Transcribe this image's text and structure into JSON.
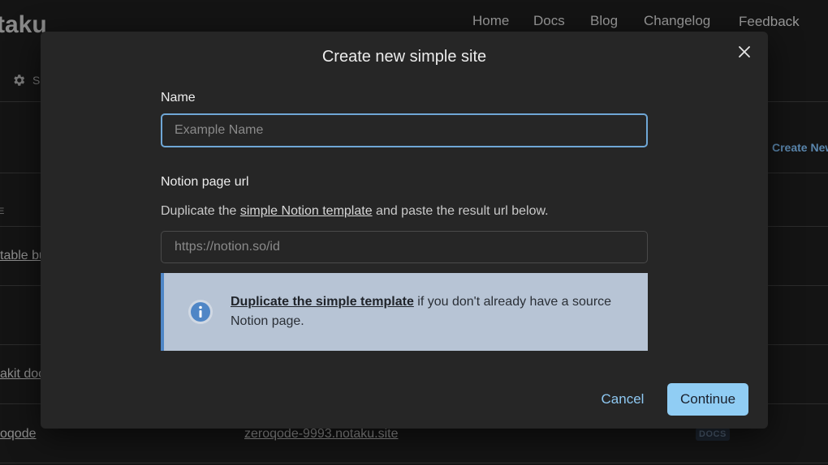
{
  "background": {
    "logo_text": "taku",
    "nav": {
      "home": "Home",
      "docs": "Docs",
      "blog": "Blog",
      "changelog": "Changelog",
      "feedback": "Feedback"
    },
    "settings_label": "S",
    "create_new_label": "Create New",
    "column_label": "E",
    "rows": [
      {
        "link": "table bu"
      },
      {
        "link": "akit doc"
      },
      {
        "link": "oqode"
      }
    ],
    "domain": "zeroqode-9993.notaku.site",
    "badge": "DOCS"
  },
  "modal": {
    "title": "Create new simple site",
    "close_icon": "close-icon",
    "name_field": {
      "label": "Name",
      "placeholder": "Example Name",
      "value": ""
    },
    "url_field": {
      "label": "Notion page url",
      "help_prefix": "Duplicate the ",
      "help_link": "simple Notion template",
      "help_suffix": " and paste the result url below.",
      "placeholder": "https://notion.so/id",
      "value": ""
    },
    "info": {
      "icon": "info-icon",
      "link_text": "Duplicate the simple template",
      "text": " if you don't already have a source Notion page."
    },
    "buttons": {
      "cancel": "Cancel",
      "continue": "Continue"
    }
  },
  "colors": {
    "accent": "#90cdf4",
    "focus_ring": "#6fa7d6",
    "info_bg": "#b7c4d5",
    "info_border": "#4f86c6"
  }
}
